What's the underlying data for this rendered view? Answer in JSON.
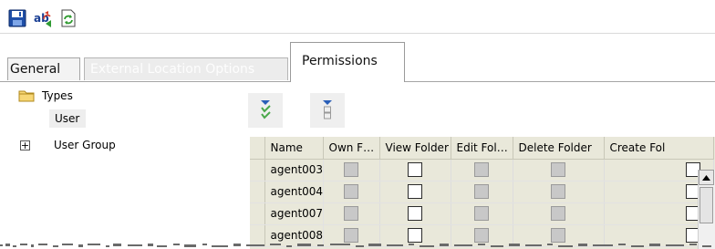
{
  "toolbar": {
    "buttons": [
      {
        "name": "save",
        "icon": "save-disk-icon"
      },
      {
        "name": "replace",
        "icon": "find-replace-icon"
      },
      {
        "name": "refresh",
        "icon": "refresh-icon"
      }
    ]
  },
  "tabs": [
    {
      "label": "General",
      "active": false
    },
    {
      "label": "External Location Options",
      "active": false
    },
    {
      "label": "Permissions",
      "active": true
    }
  ],
  "tree": {
    "root": {
      "label": "Types",
      "icon": "folder-icon"
    },
    "children": [
      {
        "label": "User",
        "selected": true
      },
      {
        "label": "User Group",
        "expander": "+"
      }
    ]
  },
  "grid_actions": [
    {
      "name": "select-all",
      "icon": "check-all-icon"
    },
    {
      "name": "clear-all",
      "icon": "clear-all-icon"
    }
  ],
  "grid": {
    "columns": [
      "Name",
      "Own F…",
      "View Folder",
      "Edit Fol…",
      "Delete Folder",
      "Create Fol"
    ],
    "rows": [
      {
        "name": "agent003",
        "checks": [
          false,
          false,
          false,
          false,
          false
        ]
      },
      {
        "name": "agent004",
        "checks": [
          false,
          false,
          false,
          false,
          false
        ]
      },
      {
        "name": "agent007",
        "checks": [
          false,
          false,
          false,
          false,
          false
        ]
      },
      {
        "name": "agent008",
        "checks": [
          false,
          false,
          false,
          false,
          false
        ]
      }
    ],
    "enabled_columns": [
      false,
      true,
      false,
      false,
      true
    ]
  },
  "colors": {
    "grid_bg": "#e9e8da",
    "tab_border": "#a5a5a5"
  }
}
